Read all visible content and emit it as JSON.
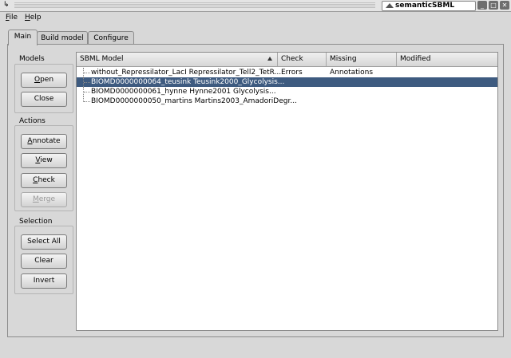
{
  "window": {
    "title": "semanticSBML",
    "minimize": "_",
    "maximize": "□",
    "close": "✕"
  },
  "menu": [
    {
      "mnemonic": "F",
      "rest": "ile"
    },
    {
      "mnemonic": "H",
      "rest": "elp"
    }
  ],
  "tabs": [
    "Main",
    "Build model",
    "Configure"
  ],
  "groups": {
    "models": {
      "label": "Models",
      "buttons": [
        {
          "mnemonic": "O",
          "rest": "pen"
        },
        {
          "mnemonic": "",
          "rest": "Close"
        }
      ]
    },
    "actions": {
      "label": "Actions",
      "buttons": [
        {
          "mnemonic": "A",
          "rest": "nnotate"
        },
        {
          "mnemonic": "V",
          "rest": "iew"
        },
        {
          "mnemonic": "C",
          "rest": "heck"
        },
        {
          "mnemonic": "M",
          "rest": "erge"
        }
      ]
    },
    "selection": {
      "label": "Selection",
      "buttons": [
        "Select All",
        "Clear",
        "Invert"
      ]
    }
  },
  "table": {
    "columns": [
      "SBML Model",
      "Check Errors",
      "Missing Annotations",
      "Modified"
    ],
    "rows": [
      "without_Repressilator_LacI Repressilator_Tell2_TetR...",
      "BIOMD0000000064_teusink Teusink2000_Glycolysis...",
      "BIOMD0000000061_hynne Hynne2001 Glycolysis...",
      "BIOMD0000000050_martins Martins2003_AmadoriDegr..."
    ],
    "selected_index": 1
  }
}
